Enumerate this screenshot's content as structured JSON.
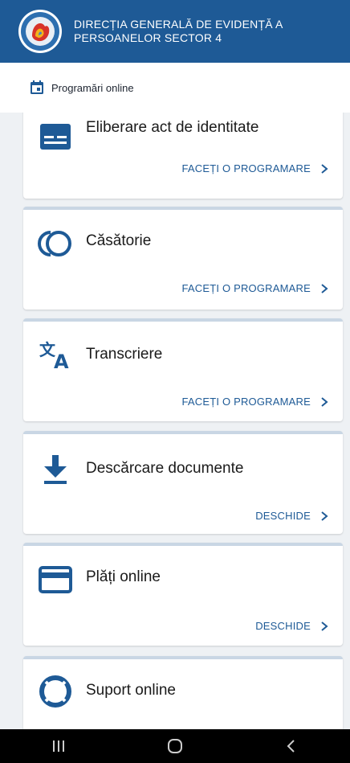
{
  "header": {
    "title": "DIRECȚIA GENERALĂ DE EVIDENȚĂ A PERSOANELOR SECTOR 4",
    "logo_icon": "dgep-logo"
  },
  "subbar": {
    "label": "Programări online",
    "icon": "calendar-icon"
  },
  "cards": [
    {
      "title": "Eliberare act de identitate",
      "action": "FACEȚI O PROGRAMARE",
      "icon": "id-card-icon"
    },
    {
      "title": "Căsătorie",
      "action": "FACEȚI O PROGRAMARE",
      "icon": "rings-icon"
    },
    {
      "title": "Transcriere",
      "action": "FACEȚI O PROGRAMARE",
      "icon": "translate-icon"
    },
    {
      "title": "Descărcare documente",
      "action": "DESCHIDE",
      "icon": "download-icon"
    },
    {
      "title": "Plăți online",
      "action": "DESCHIDE",
      "icon": "credit-card-icon"
    },
    {
      "title": "Suport online",
      "icon": "lifebuoy-icon"
    }
  ],
  "colors": {
    "primary": "#1e5a96",
    "header_bg": "#1e5a96",
    "navbar_bg": "#000000"
  },
  "navbar": [
    "recent-apps-icon",
    "home-icon",
    "back-icon"
  ]
}
